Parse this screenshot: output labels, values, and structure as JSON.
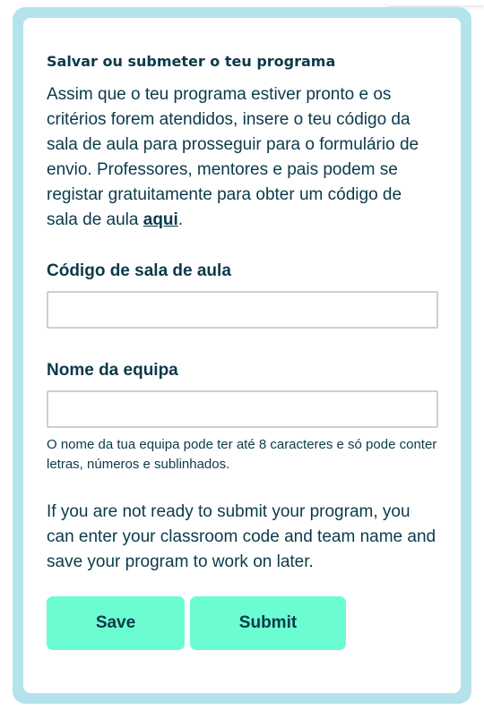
{
  "form": {
    "title": "Salvar ou submeter o teu programa",
    "intro_text": "Assim que o teu programa estiver pronto e os critérios forem atendidos, insere o teu código da sala de aula para prosseguir para o formulário de envio. Professores, mentores e pais podem se registar gratuitamente para obter um código de sala de aula ",
    "intro_link": "aqui",
    "intro_end": ".",
    "classroom_code": {
      "label": "Código de sala de aula",
      "value": "",
      "placeholder": ""
    },
    "team_name": {
      "label": "Nome da equipa",
      "value": "",
      "placeholder": "",
      "hint": "O nome da tua equipa pode ter até 8 caracteres e só pode conter letras, números e sublinhados."
    },
    "save_note": "If you are not ready to submit your program, you can enter your classroom code and team name and save your program to work on later.",
    "save_label": "Save",
    "submit_label": "Submit"
  },
  "colors": {
    "frame": "#b4e3ec",
    "button": "#6cfcd2",
    "text": "#0b3a4a",
    "input_border": "#cfcfcf"
  }
}
